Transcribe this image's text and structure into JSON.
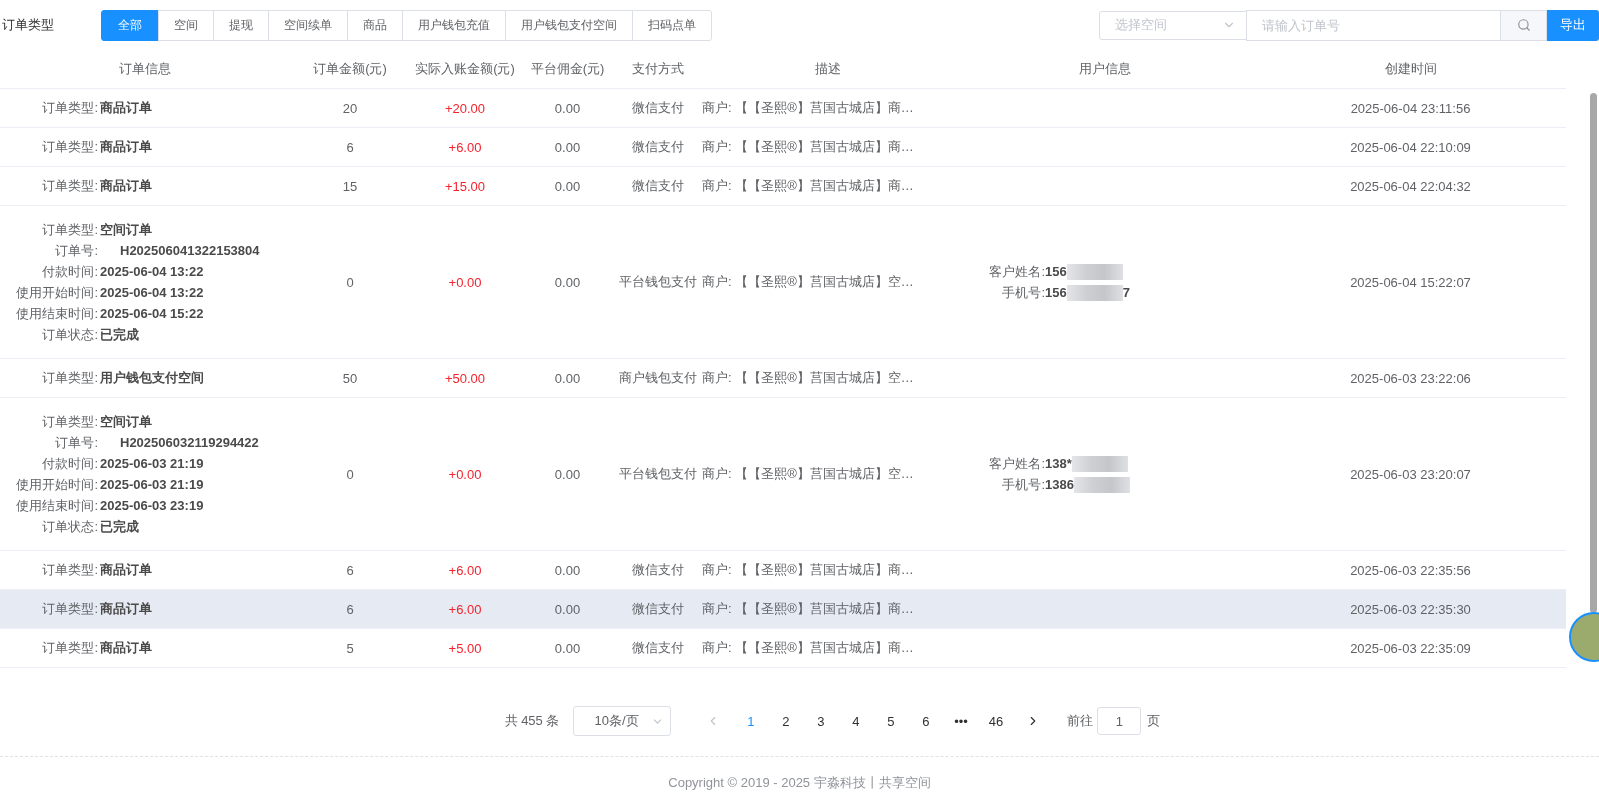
{
  "filter": {
    "label": "订单类型",
    "tabs": [
      {
        "label": "全部",
        "selected": true
      },
      {
        "label": "空间",
        "selected": false
      },
      {
        "label": "提现",
        "selected": false
      },
      {
        "label": "空间续单",
        "selected": false
      },
      {
        "label": "商品",
        "selected": false
      },
      {
        "label": "用户钱包充值",
        "selected": false
      },
      {
        "label": "用户钱包支付空间",
        "selected": false
      },
      {
        "label": "扫码点单",
        "selected": false
      }
    ],
    "space_select": {
      "placeholder": "选择空间"
    },
    "order_search": {
      "placeholder": "请输入订单号"
    },
    "export_button": "导出"
  },
  "table": {
    "columns": [
      "订单信息",
      "订单金额(元)",
      "实际入账金额(元)",
      "平台佣金(元)",
      "支付方式",
      "描述",
      "用户信息",
      "创建时间"
    ],
    "rows": [
      {
        "hovered": false,
        "info": [
          {
            "label": "订单类型:",
            "value": "商品订单"
          }
        ],
        "amount": "20",
        "actual": "+20.00",
        "commission": "0.00",
        "payment": "微信支付",
        "description": "商户: 【【圣熙®】莒国古城店】商…",
        "user": [],
        "created": "2025-06-04 23:11:56"
      },
      {
        "hovered": false,
        "info": [
          {
            "label": "订单类型:",
            "value": "商品订单"
          }
        ],
        "amount": "6",
        "actual": "+6.00",
        "commission": "0.00",
        "payment": "微信支付",
        "description": "商户: 【【圣熙®】莒国古城店】商…",
        "user": [],
        "created": "2025-06-04 22:10:09"
      },
      {
        "hovered": false,
        "info": [
          {
            "label": "订单类型:",
            "value": "商品订单"
          }
        ],
        "amount": "15",
        "actual": "+15.00",
        "commission": "0.00",
        "payment": "微信支付",
        "description": "商户: 【【圣熙®】莒国古城店】商…",
        "user": [],
        "created": "2025-06-04 22:04:32"
      },
      {
        "hovered": false,
        "info": [
          {
            "label": "订单类型:",
            "value": "空间订单"
          },
          {
            "label": "订单号:",
            "value": "H202506041322153804"
          },
          {
            "label": "付款时间:",
            "value": "2025-06-04 13:22"
          },
          {
            "label": "使用开始时间:",
            "value": "2025-06-04 13:22"
          },
          {
            "label": "使用结束时间:",
            "value": "2025-06-04 15:22"
          },
          {
            "label": "订单状态:",
            "value": "已完成"
          }
        ],
        "amount": "0",
        "actual": "+0.00",
        "commission": "0.00",
        "payment": "平台钱包支付",
        "description": "商户: 【【圣熙®】莒国古城店】空…",
        "user": [
          {
            "label": "客户姓名:",
            "value_start": "156"
          },
          {
            "label": "手机号:",
            "value_start": "156",
            "value_end": "7"
          }
        ],
        "created": "2025-06-04 15:22:07"
      },
      {
        "hovered": false,
        "info": [
          {
            "label": "订单类型:",
            "value": "用户钱包支付空间"
          }
        ],
        "amount": "50",
        "actual": "+50.00",
        "commission": "0.00",
        "payment": "商户钱包支付",
        "description": "商户: 【【圣熙®】莒国古城店】空…",
        "user": [],
        "created": "2025-06-03 23:22:06"
      },
      {
        "hovered": false,
        "info": [
          {
            "label": "订单类型:",
            "value": "空间订单"
          },
          {
            "label": "订单号:",
            "value": "H202506032119294422"
          },
          {
            "label": "付款时间:",
            "value": "2025-06-03 21:19"
          },
          {
            "label": "使用开始时间:",
            "value": "2025-06-03 21:19"
          },
          {
            "label": "使用结束时间:",
            "value": "2025-06-03 23:19"
          },
          {
            "label": "订单状态:",
            "value": "已完成"
          }
        ],
        "amount": "0",
        "actual": "+0.00",
        "commission": "0.00",
        "payment": "平台钱包支付",
        "description": "商户: 【【圣熙®】莒国古城店】空…",
        "user": [
          {
            "label": "客户姓名:",
            "value_start": "138*"
          },
          {
            "label": "手机号:",
            "value_start": "1386"
          }
        ],
        "created": "2025-06-03 23:20:07"
      },
      {
        "hovered": false,
        "info": [
          {
            "label": "订单类型:",
            "value": "商品订单"
          }
        ],
        "amount": "6",
        "actual": "+6.00",
        "commission": "0.00",
        "payment": "微信支付",
        "description": "商户: 【【圣熙®】莒国古城店】商…",
        "user": [],
        "created": "2025-06-03 22:35:56"
      },
      {
        "hovered": true,
        "info": [
          {
            "label": "订单类型:",
            "value": "商品订单"
          }
        ],
        "amount": "6",
        "actual": "+6.00",
        "commission": "0.00",
        "payment": "微信支付",
        "description": "商户: 【【圣熙®】莒国古城店】商…",
        "user": [],
        "created": "2025-06-03 22:35:30"
      },
      {
        "hovered": false,
        "info": [
          {
            "label": "订单类型:",
            "value": "商品订单"
          }
        ],
        "amount": "5",
        "actual": "+5.00",
        "commission": "0.00",
        "payment": "微信支付",
        "description": "商户: 【【圣熙®】莒国古城店】商…",
        "user": [],
        "created": "2025-06-03 22:35:09"
      }
    ]
  },
  "pagination": {
    "total": "共 455 条",
    "page_size": "10条/页",
    "pages": [
      {
        "label": "1",
        "selected": true
      },
      {
        "label": "2",
        "selected": false
      },
      {
        "label": "3",
        "selected": false
      },
      {
        "label": "4",
        "selected": false
      },
      {
        "label": "5",
        "selected": false
      },
      {
        "label": "6",
        "selected": false
      },
      {
        "label": "•••",
        "selected": false
      },
      {
        "label": "46",
        "selected": false
      }
    ],
    "goto_label": "前往",
    "goto_value": "1",
    "page_unit": "页"
  },
  "footer": "Copyright © 2019 - 2025 宇淼科技丨共享空间"
}
